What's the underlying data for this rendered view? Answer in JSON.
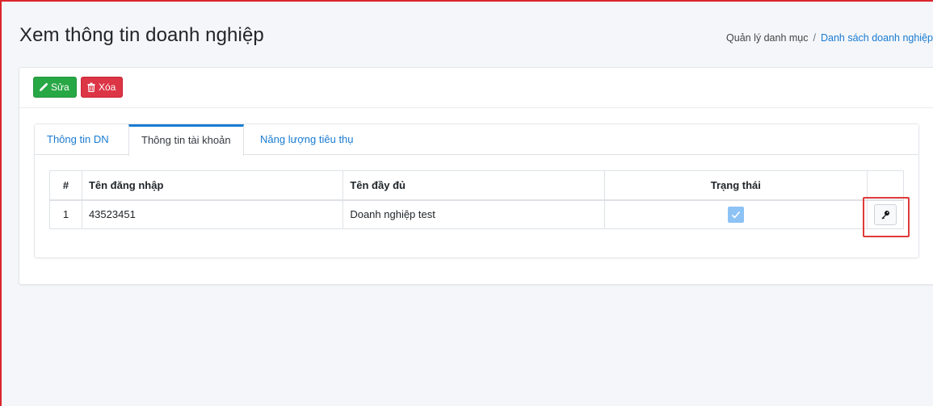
{
  "header": {
    "title": "Xem thông tin doanh nghiệp",
    "breadcrumb": {
      "parent": "Quản lý danh mục",
      "separator": "/",
      "current": "Danh sách doanh nghiệp"
    }
  },
  "toolbar": {
    "edit_label": "Sửa",
    "delete_label": "Xóa",
    "edit_icon": "pencil-icon",
    "delete_icon": "trash-icon"
  },
  "tabs": [
    {
      "label": "Thông tin DN",
      "active": false
    },
    {
      "label": "Thông tin tài khoản",
      "active": true
    },
    {
      "label": "Năng lượng tiêu thụ",
      "active": false
    }
  ],
  "accounts_table": {
    "columns": {
      "num": "#",
      "username": "Tên đăng nhập",
      "fullname": "Tên đầy đủ",
      "status": "Trạng thái"
    },
    "rows": [
      {
        "num": "1",
        "username": "43523451",
        "fullname": "Doanh nghiệp test",
        "status_checked": true,
        "action_icon": "key-icon"
      }
    ]
  },
  "colors": {
    "accent": "#1a7bd1",
    "edit": "#28a745",
    "delete": "#dc3545",
    "highlight": "#e03a3a"
  }
}
